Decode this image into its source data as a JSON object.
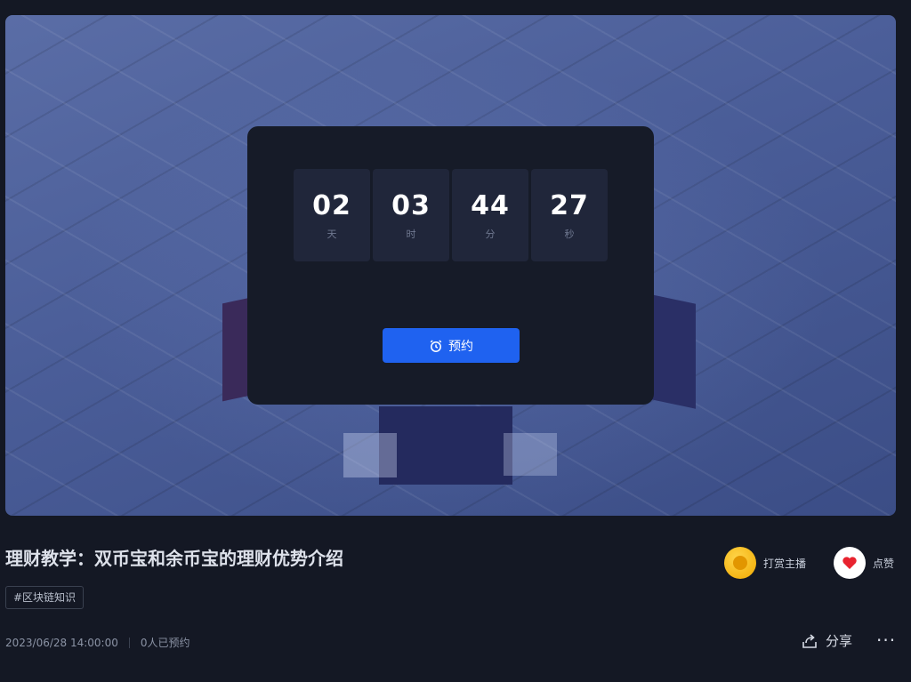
{
  "countdown": {
    "units": [
      {
        "value": "02",
        "label": "天"
      },
      {
        "value": "03",
        "label": "时"
      },
      {
        "value": "44",
        "label": "分"
      },
      {
        "value": "27",
        "label": "秒"
      }
    ],
    "reserve_label": "预约"
  },
  "video": {
    "title": "理财教学：双币宝和余币宝的理财优势介绍",
    "tag": "#区块链知识",
    "datetime": "2023/06/28 14:00:00",
    "reservations": "0人已预约"
  },
  "actions": {
    "tip_label": "打赏主播",
    "like_label": "点赞",
    "share_label": "分享",
    "more_label": "···"
  },
  "colors": {
    "accent": "#1f62f0",
    "background": "#141824",
    "like": "#e8232f",
    "coin": "#f0a800"
  },
  "icons": {
    "reserve": "alarm-clock-icon",
    "tip": "coin-icon",
    "like": "heart-icon",
    "share": "share-icon",
    "more": "more-dots-icon"
  }
}
